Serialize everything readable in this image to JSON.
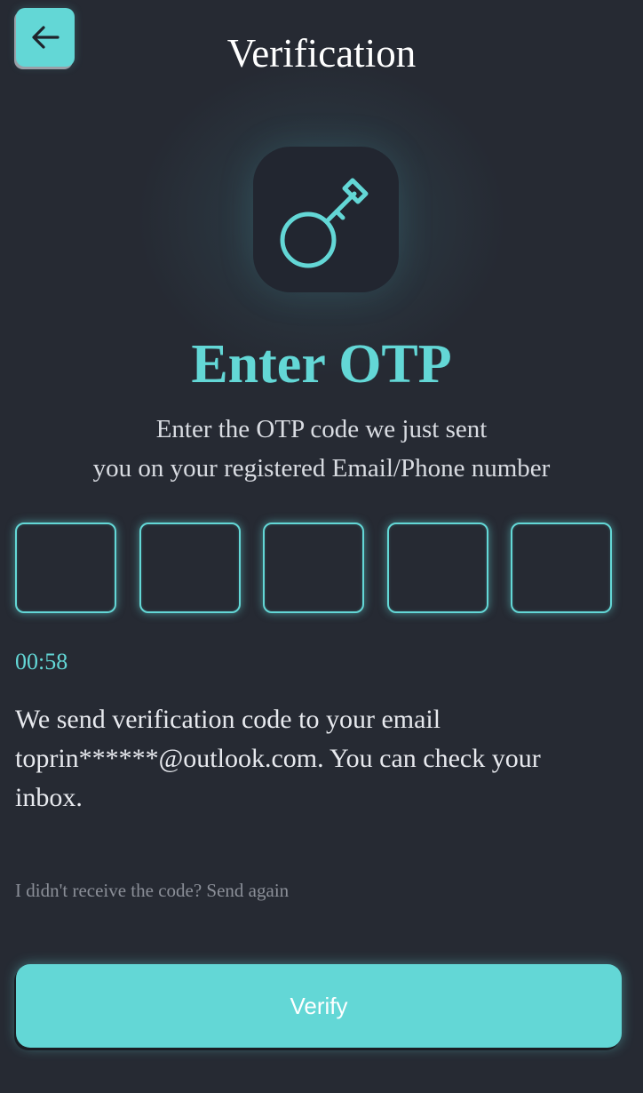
{
  "header": {
    "title": "Verification",
    "back_icon": "arrow-left-icon"
  },
  "hero": {
    "icon": "key-icon",
    "heading": "Enter OTP",
    "subtitle_line1": "Enter the OTP code we just sent",
    "subtitle_line2": "you on your registered Email/Phone number"
  },
  "otp": {
    "digits": [
      "",
      "",
      "",
      "",
      ""
    ]
  },
  "timer": "00:58",
  "info_text": "We send verification code to your email toprin******@outlook.com. You can check your inbox.",
  "resend_text": "I didn't receive the code? Send again",
  "verify_label": "Verify",
  "colors": {
    "accent": "#63d7d6",
    "background": "#262a33",
    "tile": "#222630",
    "muted_text": "#8b8f98"
  }
}
